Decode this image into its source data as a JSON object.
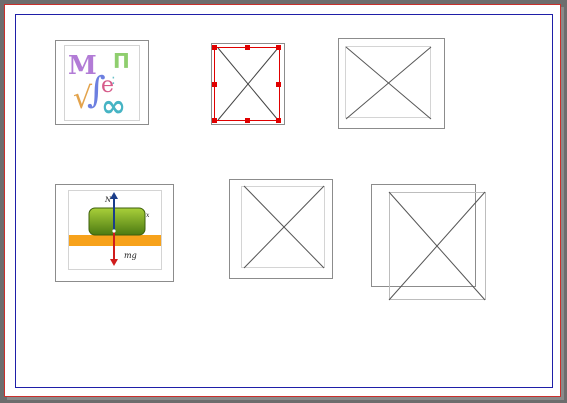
{
  "colors": {
    "background": "#6d6d6d",
    "page": "#ffffff",
    "page_border": "#c9302c",
    "margin_guide": "#1f1fa8",
    "selection": "#e00000",
    "frame_border": "#8c8c8c"
  },
  "objects": [
    {
      "id": "math-symbols-clipart",
      "kind": "image",
      "icon": "math-symbols-icon",
      "selected": false
    },
    {
      "id": "placeholder-selected",
      "kind": "empty-image-placeholder",
      "selected": true
    },
    {
      "id": "placeholder-1",
      "kind": "empty-image-placeholder",
      "selected": false
    },
    {
      "id": "physics-diagram",
      "kind": "image",
      "icon": "force-diagram-icon",
      "selected": false
    },
    {
      "id": "placeholder-2",
      "kind": "empty-image-placeholder",
      "selected": false
    },
    {
      "id": "placeholder-3",
      "kind": "empty-image-placeholder",
      "selected": false
    }
  ],
  "physics_diagram": {
    "normal_force_label": "N",
    "weight_label": "mg",
    "friction_label": "x"
  }
}
